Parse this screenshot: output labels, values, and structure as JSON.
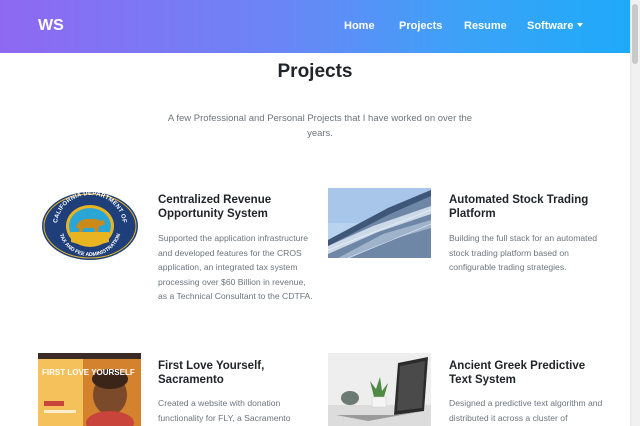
{
  "nav": {
    "brand": "WS",
    "items": [
      {
        "label": "Home"
      },
      {
        "label": "Projects"
      },
      {
        "label": "Resume"
      },
      {
        "label": "Software"
      }
    ]
  },
  "page": {
    "title": "Projects",
    "subtitle": "A few Professional and Personal Projects that I have worked on over the years."
  },
  "projects": [
    {
      "title": "Centralized Revenue Opportunity System",
      "description": "Supported the application infrastructure and developed features for the CROS application, an integrated tax system processing over $60 Billion in revenue, as a Technical Consultant to the CDTFA.",
      "logo_text_top": "CALIFORNIA DEPARTMENT OF",
      "logo_text_bottom": "TAX AND FEE ADMINISTRATION"
    },
    {
      "title": "Automated Stock Trading Platform",
      "description": "Building the full stack for an automated stock trading platform based on configurable trading strategies."
    },
    {
      "title": "First Love Yourself, Sacramento",
      "description": "Created a website with donation functionality for FLY, a Sacramento",
      "image_text": "FIRST LOVE YOURSELF"
    },
    {
      "title": "Ancient Greek Predictive Text System",
      "description": "Designed a predictive text algorithm and distributed it across a cluster of"
    }
  ],
  "colors": {
    "nav_gradient_start": "#8f68f2",
    "nav_gradient_end": "#1eaaf9",
    "heading": "#212529",
    "muted_text": "#6c757d"
  }
}
